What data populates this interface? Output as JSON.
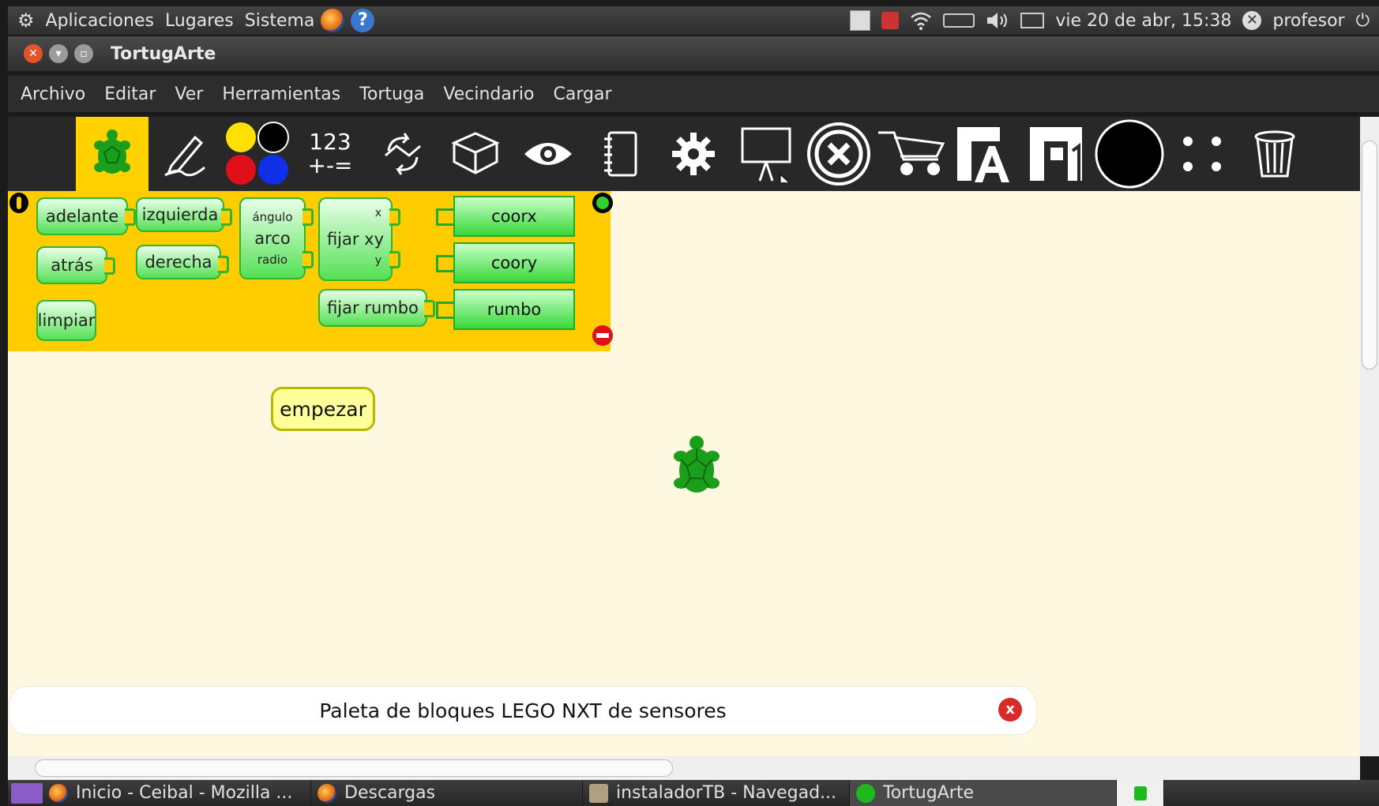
{
  "top_panel": {
    "menus": [
      "Aplicaciones",
      "Lugares",
      "Sistema"
    ],
    "datetime": "vie 20 de abr, 15:38",
    "user": "profesor"
  },
  "window": {
    "title": "TortugArte"
  },
  "menubar": [
    "Archivo",
    "Editar",
    "Ver",
    "Herramientas",
    "Tortuga",
    "Vecindario",
    "Cargar"
  ],
  "toolbar": {
    "numbers_label_top": "123",
    "numbers_label_bottom": "+-=",
    "icons": [
      "turtle-palette-icon",
      "pen-palette-icon",
      "colors-palette-icon",
      "numbers-palette-icon",
      "flow-palette-icon",
      "blocks-palette-icon",
      "sensors-palette-icon",
      "media-palette-icon",
      "extras-palette-icon",
      "presentation-icon",
      "stop-icon",
      "cart-icon",
      "font-a-icon",
      "font-one-icon",
      "black-circle-icon",
      "dots-icon",
      "trash-icon"
    ]
  },
  "palette": {
    "blocks": {
      "adelante": "adelante",
      "izquierda": "izquierda",
      "angulo": "ángulo",
      "arco": "arco",
      "radio": "radio",
      "fijar_xy": "fijar xy",
      "x": "x",
      "y": "y",
      "atras": "atrás",
      "derecha": "derecha",
      "limpiar": "limpiar",
      "fijar_rumbo": "fijar rumbo",
      "coorx": "coorx",
      "coory": "coory",
      "rumbo": "rumbo"
    }
  },
  "canvas": {
    "start_block": "empezar"
  },
  "status_bar": {
    "message": "Paleta de bloques LEGO NXT de sensores"
  },
  "taskbar": {
    "tasks": [
      "Inicio - Ceibal - Mozilla ...",
      "Descargas",
      "instaladorTB - Navegad...",
      "TortugArte"
    ]
  },
  "colors": {
    "palette_bg": "#ffcc00",
    "canvas_bg": "#fff8e1",
    "block_green": "#55e055",
    "start_block": "#ffff9a"
  }
}
